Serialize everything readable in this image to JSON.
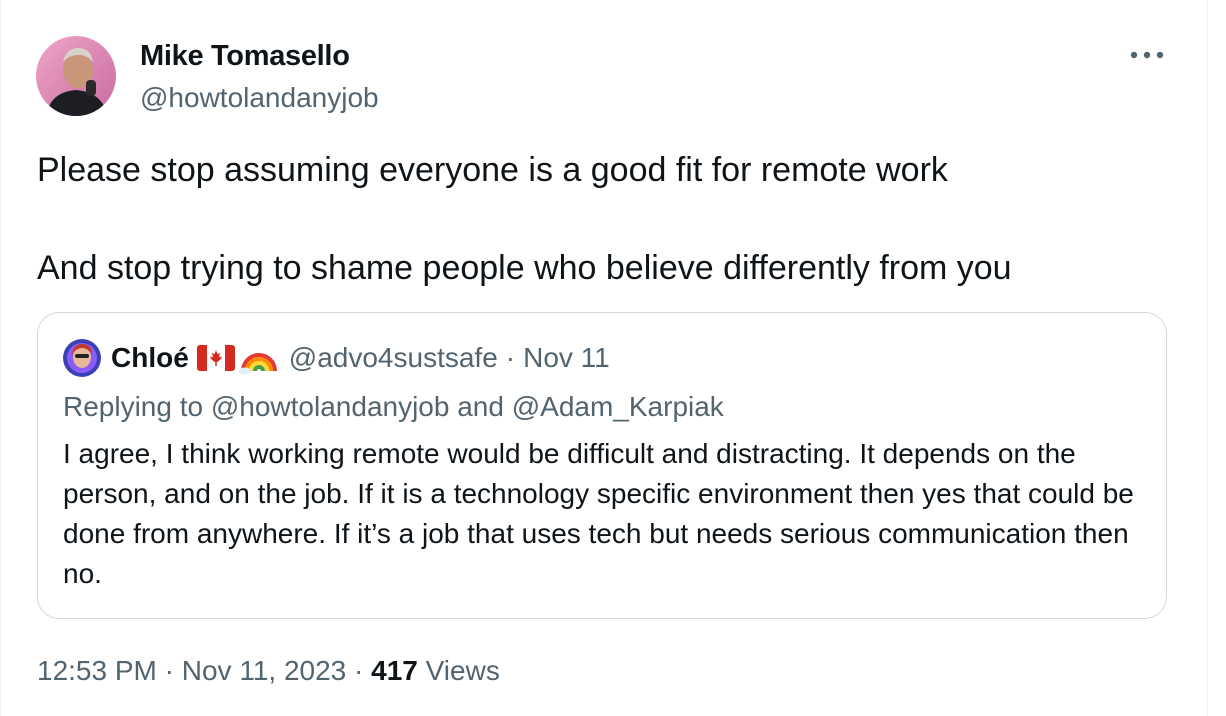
{
  "author": {
    "name": "Mike Tomasello",
    "handle": "@howtolandanyjob"
  },
  "tweet": {
    "line1": "Please stop assuming everyone is a good fit for remote work",
    "line2": "And stop trying to shame people who believe differently from you"
  },
  "quoted": {
    "name": "Chloé",
    "handle": "@advo4sustsafe",
    "separator": "·",
    "date": "Nov 11",
    "replying_to": "Replying to @howtolandanyjob and @Adam_Karpiak",
    "text": "I agree, I think working remote would be difficult and distracting. It depends on the person, and on the job. If it is a technology specific environment then yes that could be done from anywhere. If it’s a job that uses tech but needs serious communication then no."
  },
  "meta": {
    "time": "12:53 PM",
    "separator1": "·",
    "date": "Nov 11, 2023",
    "separator2": "·",
    "views_count": "417",
    "views_label": "Views"
  },
  "icons": {
    "more": "more-horizontal-icon",
    "flag": "canada-flag-icon",
    "rainbow": "rainbow-icon"
  },
  "colors": {
    "text": "#0f1419",
    "secondary": "#536471",
    "border": "#cfd9de"
  }
}
